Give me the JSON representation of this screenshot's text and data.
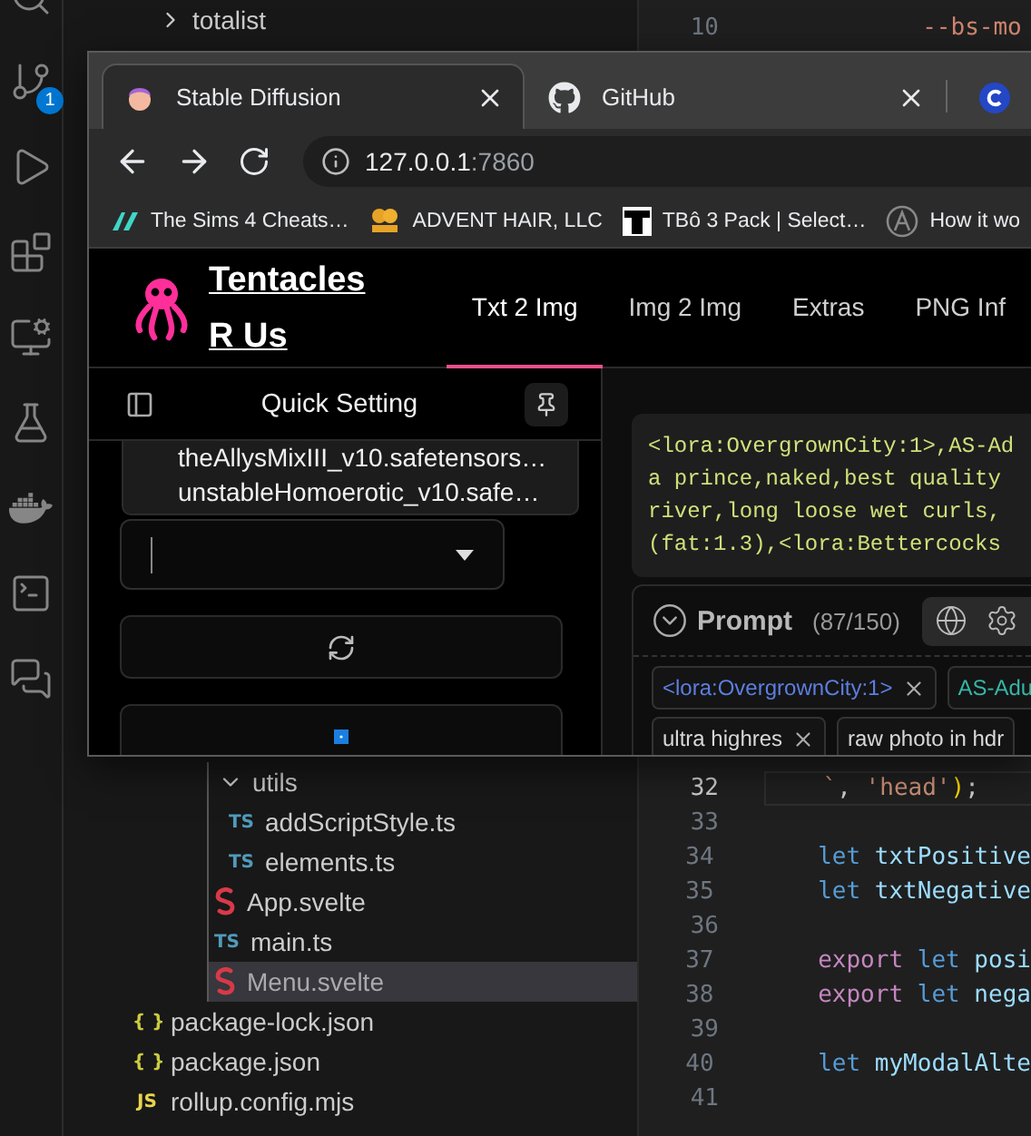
{
  "activity_bar": {
    "items": [
      {
        "kind": "search"
      },
      {
        "kind": "source-control",
        "badge": "1"
      },
      {
        "kind": "run"
      },
      {
        "kind": "extensions"
      },
      {
        "kind": "remote"
      },
      {
        "kind": "testing"
      },
      {
        "kind": "docker"
      },
      {
        "kind": "terminal"
      },
      {
        "kind": "chat"
      }
    ]
  },
  "explorer": {
    "top_items": [
      {
        "label": "totalist",
        "kind": "folder",
        "expanded": false,
        "selected": false
      }
    ],
    "items": [
      {
        "label": "utils",
        "kind": "folder",
        "expanded": true,
        "selected": false,
        "children": [
          {
            "label": "addScriptStyle.ts",
            "kind": "ts",
            "icon_text": "TS",
            "selected": false
          },
          {
            "label": "elements.ts",
            "kind": "ts",
            "icon_text": "TS",
            "selected": false
          }
        ]
      },
      {
        "label": "App.svelte",
        "kind": "svelte",
        "selected": false
      },
      {
        "label": "main.ts",
        "kind": "ts",
        "icon_text": "TS",
        "selected": false
      },
      {
        "label": "Menu.svelte",
        "kind": "svelte",
        "selected": true
      }
    ],
    "root_items": [
      {
        "label": "package-lock.json",
        "kind": "json",
        "icon_text": "{ }",
        "selected": false
      },
      {
        "label": "package.json",
        "kind": "json",
        "icon_text": "{ }",
        "selected": false
      },
      {
        "label": "rollup.config.mjs",
        "kind": "js",
        "icon_text": "JS",
        "selected": false
      }
    ]
  },
  "editor": {
    "top_lines": [
      {
        "number": "10",
        "current": false,
        "tokens": [
          {
            "t": "           --bs-mo",
            "kind": "property"
          }
        ]
      }
    ],
    "bottom_lines": [
      {
        "number": "32",
        "current": true,
        "tokens": [
          {
            "t": "    `",
            "kind": "string"
          },
          {
            "t": ", ",
            "kind": "punct"
          },
          {
            "t": "'head'",
            "kind": "string"
          },
          {
            "t": ")",
            "kind": "bracket"
          },
          {
            "t": ";",
            "kind": "punct"
          }
        ]
      },
      {
        "number": "33",
        "current": false
      },
      {
        "number": "34",
        "current": false,
        "tokens": [
          {
            "t": "    let",
            "kind": "storage"
          },
          {
            "t": " txtPositive",
            "kind": "variable"
          }
        ]
      },
      {
        "number": "35",
        "current": false,
        "tokens": [
          {
            "t": "    let",
            "kind": "storage"
          },
          {
            "t": " txtNegative",
            "kind": "variable"
          }
        ]
      },
      {
        "number": "36",
        "current": false
      },
      {
        "number": "37",
        "current": false,
        "tokens": [
          {
            "t": "    export",
            "kind": "keyword"
          },
          {
            "t": " let",
            "kind": "storage"
          },
          {
            "t": " posi",
            "kind": "variable"
          }
        ]
      },
      {
        "number": "38",
        "current": false,
        "tokens": [
          {
            "t": "    export",
            "kind": "keyword"
          },
          {
            "t": " let",
            "kind": "storage"
          },
          {
            "t": " nega",
            "kind": "variable"
          }
        ]
      },
      {
        "number": "39",
        "current": false
      },
      {
        "number": "40",
        "current": false,
        "tokens": [
          {
            "t": "    let",
            "kind": "storage"
          },
          {
            "t": " myModalAlte",
            "kind": "variable"
          }
        ]
      },
      {
        "number": "41",
        "current": false
      }
    ]
  },
  "browser": {
    "tabs": [
      {
        "title": "Stable Diffusion",
        "kind": "avatar",
        "selected": true,
        "closable": true
      },
      {
        "title": "GitHub",
        "kind": "github",
        "selected": false,
        "closable": true
      },
      {
        "kind": "c-logo",
        "selected": false,
        "closable": false
      }
    ],
    "address": {
      "host": "127.0.0.1",
      "port": ":7860"
    },
    "bookmarks": [
      {
        "label": "The Sims 4 Cheats…",
        "kind": "sims"
      },
      {
        "label": "ADVENT HAIR, LLC",
        "kind": "hair"
      },
      {
        "label": "TBô 3 Pack | Select…",
        "kind": "t-logo"
      },
      {
        "label": "How it wo",
        "kind": "circle"
      }
    ],
    "page": {
      "brand": {
        "line1": "Tentacles",
        "line2": "R Us"
      },
      "nav": [
        {
          "label": "Txt 2 Img",
          "selected": true
        },
        {
          "label": "Img 2 Img",
          "selected": false
        },
        {
          "label": "Extras",
          "selected": false
        },
        {
          "label": "PNG Inf",
          "selected": false
        }
      ],
      "quick_setting": {
        "title": "Quick Setting",
        "pinned": false,
        "dropdown_options": [
          "theAllysMixIII_v10.safetensors…",
          "unstableHomoerotic_v10.safe…"
        ]
      },
      "prompt": {
        "text_lines": [
          "<lora:OvergrownCity:1>,AS-Ad",
          "a prince,naked,best quality",
          "river,long loose wet curls,",
          "(fat:1.3),<lora:Bettercocks"
        ],
        "title": "Prompt",
        "count": "(87/150)",
        "expanded": true,
        "tag_rows": [
          {
            "tags": [
              {
                "label": "<lora:OvergrownCity:1>",
                "color": "#5c7ee0",
                "removable": true
              },
              {
                "label": "AS-Adu",
                "color": "#36b5a6",
                "removable": false
              }
            ]
          },
          {
            "tags": [
              {
                "label": "ultra highres",
                "color": "#d8d8d8",
                "removable": true
              },
              {
                "label": "raw photo in hdr",
                "color": "#d8d8d8",
                "removable": false
              }
            ]
          }
        ]
      }
    }
  }
}
